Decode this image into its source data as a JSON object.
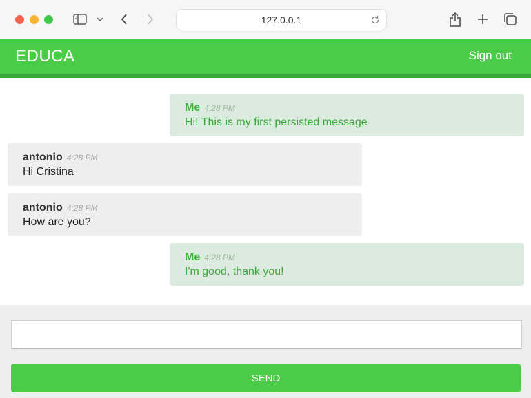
{
  "browser": {
    "url": "127.0.0.1"
  },
  "app": {
    "brand": "EDUCA",
    "signout_label": "Sign out",
    "accent_color": "#4bcc48"
  },
  "messages": [
    {
      "author": "Me",
      "time": "4:28 PM",
      "text": "Hi! This is my first persisted message",
      "from_me": true
    },
    {
      "author": "antonio",
      "time": "4:28 PM",
      "text": "Hi Cristina",
      "from_me": false
    },
    {
      "author": "antonio",
      "time": "4:28 PM",
      "text": "How are you?",
      "from_me": false
    },
    {
      "author": "Me",
      "time": "4:28 PM",
      "text": "I'm good, thank you!",
      "from_me": true
    }
  ],
  "composer": {
    "input_value": "",
    "send_label": "SEND"
  }
}
